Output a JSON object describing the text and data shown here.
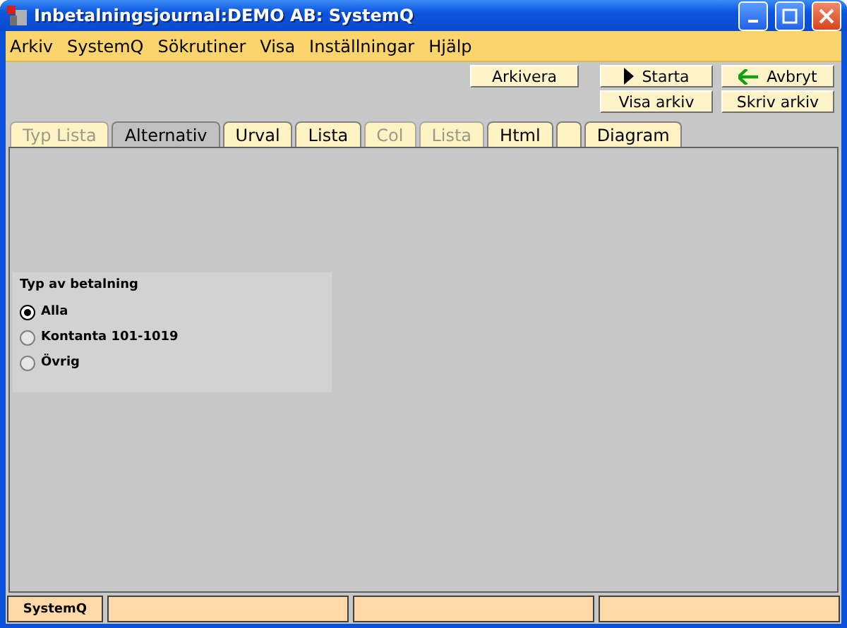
{
  "window": {
    "title": "Inbetalningsjournal:DEMO AB: SystemQ"
  },
  "menu": [
    {
      "label": "Arkiv"
    },
    {
      "label": "SystemQ"
    },
    {
      "label": "Sökrutiner"
    },
    {
      "label": "Visa"
    },
    {
      "label": "Inställningar"
    },
    {
      "label": "Hjälp"
    }
  ],
  "toolbar": [
    {
      "label": "Arkivera",
      "kind": "plain"
    },
    {
      "label": "Starta",
      "kind": "play"
    },
    {
      "label": "Avbryt",
      "kind": "back"
    },
    {
      "label": "Visa arkiv",
      "kind": "plain"
    },
    {
      "label": "Skriv arkiv",
      "kind": "plain"
    }
  ],
  "tabs": [
    {
      "label": "Typ Lista",
      "selected": false,
      "disabled": true
    },
    {
      "label": "Alternativ",
      "selected": true,
      "disabled": false
    },
    {
      "label": "Urval",
      "selected": false,
      "disabled": false
    },
    {
      "label": "Lista",
      "selected": false,
      "disabled": false
    },
    {
      "label": "Col",
      "selected": false,
      "disabled": true
    },
    {
      "label": "Lista",
      "selected": false,
      "disabled": true
    },
    {
      "label": "Html",
      "selected": false,
      "disabled": false
    },
    {
      "selected": false,
      "disabled": false
    },
    {
      "label": "Diagram",
      "selected": false,
      "disabled": false
    }
  ],
  "payment_type": {
    "title": "Typ av betalning",
    "options": [
      {
        "label": "Alla",
        "selected": true
      },
      {
        "label": "Kontanta 101-1019",
        "selected": false
      },
      {
        "label": "Övrig",
        "selected": false
      }
    ]
  },
  "status_bar": {
    "text": "SystemQ"
  }
}
